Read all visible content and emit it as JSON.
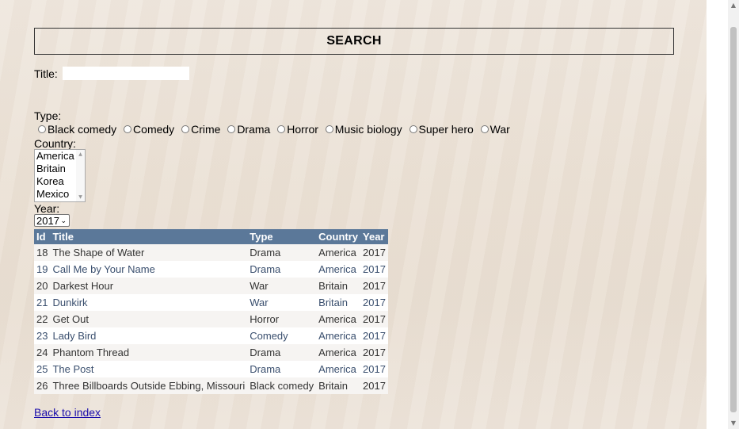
{
  "search": {
    "label": "SEARCH"
  },
  "title_field": {
    "label": "Title:",
    "value": ""
  },
  "type_filter": {
    "label": "Type:",
    "options": [
      "Black comedy",
      "Comedy",
      "Crime",
      "Drama",
      "Horror",
      "Music biology",
      "Super hero",
      "War"
    ]
  },
  "country_filter": {
    "label": "Country:",
    "options": [
      "America",
      "Britain",
      "Korea",
      "Mexico"
    ]
  },
  "year_filter": {
    "label": "Year:",
    "selected": "2017"
  },
  "table": {
    "headers": [
      "Id",
      "Title",
      "Type",
      "Country",
      "Year"
    ],
    "rows": [
      [
        "18",
        "The Shape of Water",
        "Drama",
        "America",
        "2017"
      ],
      [
        "19",
        "Call Me by Your Name",
        "Drama",
        "America",
        "2017"
      ],
      [
        "20",
        "Darkest Hour",
        "War",
        "Britain",
        "2017"
      ],
      [
        "21",
        "Dunkirk",
        "War",
        "Britain",
        "2017"
      ],
      [
        "22",
        "Get Out",
        "Horror",
        "America",
        "2017"
      ],
      [
        "23",
        "Lady Bird",
        "Comedy",
        "America",
        "2017"
      ],
      [
        "24",
        "Phantom Thread",
        "Drama",
        "America",
        "2017"
      ],
      [
        "25",
        "The Post",
        "Drama",
        "America",
        "2017"
      ],
      [
        "26",
        "Three Billboards Outside Ebbing, Missouri",
        "Black comedy",
        "Britain",
        "2017"
      ]
    ]
  },
  "back_link": {
    "label": "Back to index"
  },
  "colors": {
    "header_bg": "#5b7899",
    "link": "#1a0dab"
  }
}
